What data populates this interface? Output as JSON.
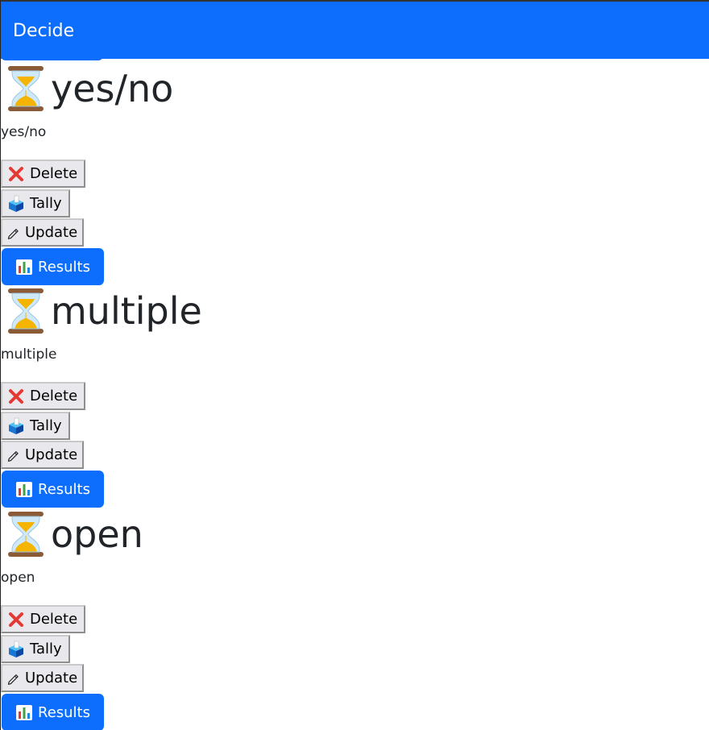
{
  "app": {
    "brand": "Decide"
  },
  "polls": [
    {
      "name": "yes/no",
      "description": "yes/no",
      "icon": "hourglass-icon"
    },
    {
      "name": "multiple",
      "description": "multiple",
      "icon": "hourglass-icon"
    },
    {
      "name": "open",
      "description": "open",
      "icon": "hourglass-icon"
    }
  ],
  "actions": {
    "delete_label": "Delete",
    "tally_label": "Tally",
    "update_label": "Update",
    "results_label": "Results"
  },
  "colors": {
    "primary": "#0d6efd",
    "button_gray": "#e9e9ed",
    "text": "#212529"
  }
}
